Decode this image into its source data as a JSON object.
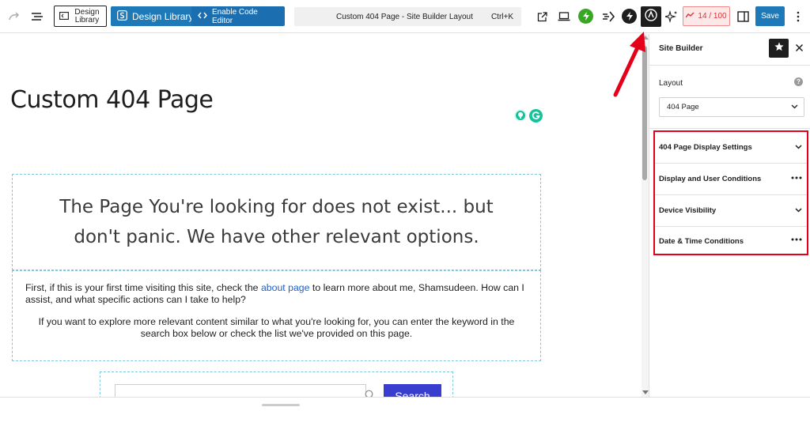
{
  "toolbar": {
    "design_library_small": "Design Library",
    "design_library_button": "Design Library",
    "enable_code_editor": "Enable Code Editor",
    "command_title": "Custom 404 Page - Site Builder Layout",
    "command_shortcut": "Ctrl+K",
    "counter": "14 / 100",
    "save": "Save"
  },
  "canvas": {
    "page_title": "Custom 404 Page",
    "heading": "The Page You're looking for does not exist... but don't panic. We have other relevant options.",
    "para1_before": "First, if this is your first time visiting this site, check the ",
    "para1_link": "about page",
    "para1_after": " to learn more about me, Shamsudeen. How can I assist, and what specific actions can I take to help?",
    "para2": "If you want to explore more relevant content similar to what you're looking for, you can enter the keyword in the search box below or check the list we've provided on this page.",
    "search_button": "Search"
  },
  "sidebar": {
    "title": "Site Builder",
    "layout_label": "Layout",
    "layout_value": "404 Page",
    "panels": [
      {
        "label": "404 Page Display Settings",
        "control": "chevron"
      },
      {
        "label": "Display and User Conditions",
        "control": "dots"
      },
      {
        "label": "Device Visibility",
        "control": "chevron"
      },
      {
        "label": "Date & Time Conditions",
        "control": "dots"
      }
    ]
  },
  "colors": {
    "accent_blue": "#1d79b8",
    "highlight_red": "#e5001a",
    "search_button": "#3a3ecf",
    "link": "#1f5ec8"
  }
}
